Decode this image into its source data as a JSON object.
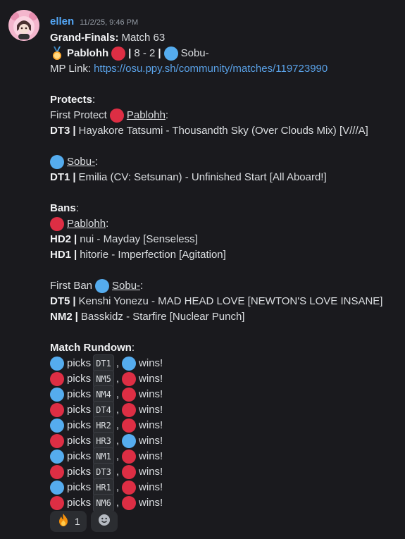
{
  "message": {
    "author": "ellen",
    "timestamp": "11/2/25, 9:46 PM",
    "grand_finals_label": "Grand-Finals:",
    "match_text": "Match 63",
    "player_red": "Pablohh",
    "score": "8 - 2",
    "player_blue": "Sobu-",
    "mp_link_label": "MP Link:",
    "mp_link_url": "https://osu.ppy.sh/community/matches/119723990",
    "protects_title": "Protects",
    "first_protect_label": "First Protect",
    "protect_red": {
      "mod": "DT3",
      "map": "Hayakore Tatsumi - Thousandth Sky (Over Clouds Mix) [V///A]"
    },
    "protect_blue": {
      "mod": "DT1",
      "map": "Emilia (CV: Setsunan) - Unfinished Start [All Aboard!]"
    },
    "bans_title": "Bans",
    "bans_red": [
      {
        "mod": "HD2",
        "map": "nui - Mayday [Senseless]"
      },
      {
        "mod": "HD1",
        "map": "hitorie - Imperfection [Agitation]"
      }
    ],
    "first_ban_label": "First Ban",
    "bans_blue": [
      {
        "mod": "DT5",
        "map": "Kenshi Yonezu - MAD HEAD LOVE [NEWTON'S LOVE INSANE]"
      },
      {
        "mod": "NM2",
        "map": "Basskidz - Starfire [Nuclear Punch]"
      }
    ],
    "rundown_title": "Match Rundown",
    "picks_word": "picks",
    "wins_word": "wins!",
    "rundown": [
      {
        "picker": "blue",
        "map": "DT1",
        "winner": "blue"
      },
      {
        "picker": "red",
        "map": "NM5",
        "winner": "red"
      },
      {
        "picker": "blue",
        "map": "NM4",
        "winner": "red"
      },
      {
        "picker": "red",
        "map": "DT4",
        "winner": "red"
      },
      {
        "picker": "blue",
        "map": "HR2",
        "winner": "red"
      },
      {
        "picker": "red",
        "map": "HR3",
        "winner": "blue"
      },
      {
        "picker": "blue",
        "map": "NM1",
        "winner": "red"
      },
      {
        "picker": "red",
        "map": "DT3",
        "winner": "red"
      },
      {
        "picker": "blue",
        "map": "HR1",
        "winner": "red"
      },
      {
        "picker": "red",
        "map": "NM6",
        "winner": "red"
      }
    ]
  },
  "reactions": [
    {
      "icon": "fire-icon",
      "count": "1"
    },
    {
      "icon": "add-reaction-icon"
    }
  ],
  "colors": {
    "background": "#1a1a1e",
    "username": "#53a6f5",
    "link": "#5aa2e8",
    "red_team": "#dd2e44",
    "blue_team": "#55acee"
  }
}
